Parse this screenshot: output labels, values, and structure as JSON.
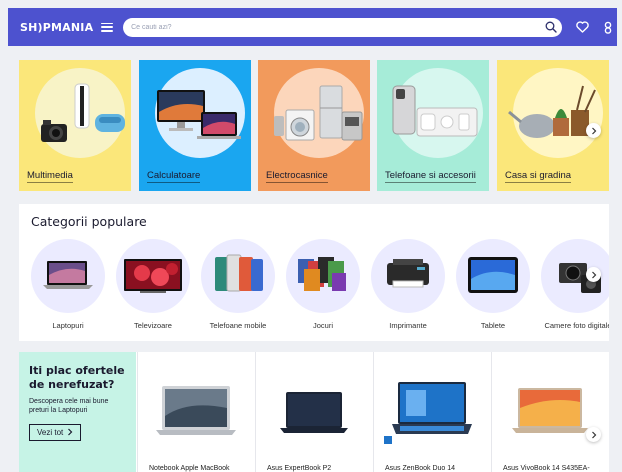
{
  "header": {
    "logo": "SH)PMANIA",
    "search_placeholder": "Ce cauti azi?",
    "icons": [
      "menu-icon",
      "search-icon",
      "heart-icon",
      "user-icon"
    ],
    "accent": "#4d52cf"
  },
  "categories": [
    {
      "label": "Multimedia",
      "bg": "#fbe77a",
      "circle": "#f8f3c6"
    },
    {
      "label": "Calculatoare",
      "bg": "#1aa6f0",
      "circle": "#dcefff"
    },
    {
      "label": "Electrocasnice",
      "bg": "#f29a5c",
      "circle": "#fcd6bb"
    },
    {
      "label": "Telefoane si accesorii",
      "bg": "#a6ecd8",
      "circle": "#d7f7ef"
    },
    {
      "label": "Casa si gradina",
      "bg": "#fbe77a",
      "circle": "#fff6c4"
    }
  ],
  "popular": {
    "title": "Categorii populare",
    "items": [
      {
        "label": "Laptopuri"
      },
      {
        "label": "Televizoare"
      },
      {
        "label": "Telefoane mobile"
      },
      {
        "label": "Jocuri"
      },
      {
        "label": "Imprimante"
      },
      {
        "label": "Tablete"
      },
      {
        "label": "Camere foto digitale"
      }
    ]
  },
  "offers": {
    "title": "Iti plac ofertele de nerefuzat?",
    "subtitle": "Descopera cele mai bune preturi la Laptopuri",
    "button": "Vezi tot",
    "products": [
      {
        "name": "Notebook Apple MacBook"
      },
      {
        "name": "Asus ExpertBook P2"
      },
      {
        "name": "Asus ZenBook Duo 14"
      },
      {
        "name": "Asus VivoBook 14 S435EA-"
      }
    ]
  }
}
